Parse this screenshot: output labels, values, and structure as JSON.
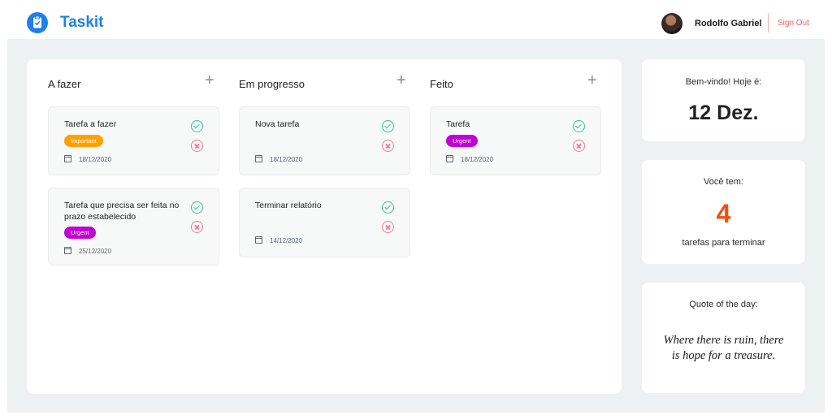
{
  "header": {
    "app_name": "Taskit",
    "user_name": "Rodolfo Gabriel",
    "sign_out": "Sign Out"
  },
  "columns": [
    {
      "title": "A fazer",
      "add_label": "+",
      "cards": [
        {
          "title": "Tarefa a fazer",
          "tag": "Important",
          "date": "18/12/2020"
        },
        {
          "title": "Tarefa que precisa ser feita no prazo estabelecido",
          "tag": "Urgent",
          "date": "25/12/2020"
        }
      ]
    },
    {
      "title": "Em progresso",
      "add_label": "+",
      "cards": [
        {
          "title": "Nova tarefa",
          "date": "18/12/2020"
        },
        {
          "title": "Terminar relatório",
          "date": "14/12/2020"
        }
      ]
    },
    {
      "title": "Feito",
      "add_label": "+",
      "cards": [
        {
          "title": "Tarefa",
          "tag": "Urgent",
          "date": "18/12/2020"
        }
      ]
    }
  ],
  "welcome": {
    "label": "Bem-vindo! Hoje é:",
    "date": "12 Dez."
  },
  "pending": {
    "label": "Você tem:",
    "count": "4",
    "suffix": "tarefas para terminar"
  },
  "quote": {
    "label": "Quote of the day:",
    "text": "Where there is ruin, there is hope for a treasure."
  },
  "colors": {
    "brand": "#1e7fe8",
    "important": "#ffa000",
    "urgent": "#c300d6",
    "count": "#f0500f",
    "sign_out": "#e8635a"
  }
}
